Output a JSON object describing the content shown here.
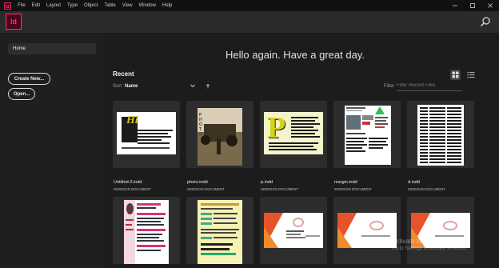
{
  "menubar": {
    "items": [
      "File",
      "Edit",
      "Layout",
      "Type",
      "Object",
      "Table",
      "View",
      "Window",
      "Help"
    ]
  },
  "app": {
    "logo_text": "Id",
    "search_icon": "search-icon"
  },
  "sidebar": {
    "home_label": "Home",
    "create_new_label": "Create New...",
    "open_label": "Open..."
  },
  "main": {
    "greeting": "Hello again. Have a great day.",
    "recent_heading": "Recent",
    "sort_label": "Sort",
    "sort_value": "Name",
    "filter_label": "Filter",
    "filter_placeholder": "Filter Recent Files"
  },
  "files": [
    {
      "name": "Untitled-2.indd",
      "type": "INDESIGN DOCUMENT"
    },
    {
      "name": "photo.indd",
      "type": "INDESIGN DOCUMENT"
    },
    {
      "name": "p.indd",
      "type": "INDESIGN DOCUMENT"
    },
    {
      "name": "margin.indd",
      "type": "INDESIGN DOCUMENT"
    },
    {
      "name": "d.indd",
      "type": "INDESIGN DOCUMENT"
    }
  ],
  "thumb_text": {
    "untitled2": "Hi",
    "photo": "PHOTO",
    "p": "P"
  },
  "watermark": {
    "line1": "Activate Windows",
    "line2": "Go to Settings to activate Windows."
  },
  "colors": {
    "accent": "#ff3366",
    "indesign_bg": "#49021f"
  }
}
